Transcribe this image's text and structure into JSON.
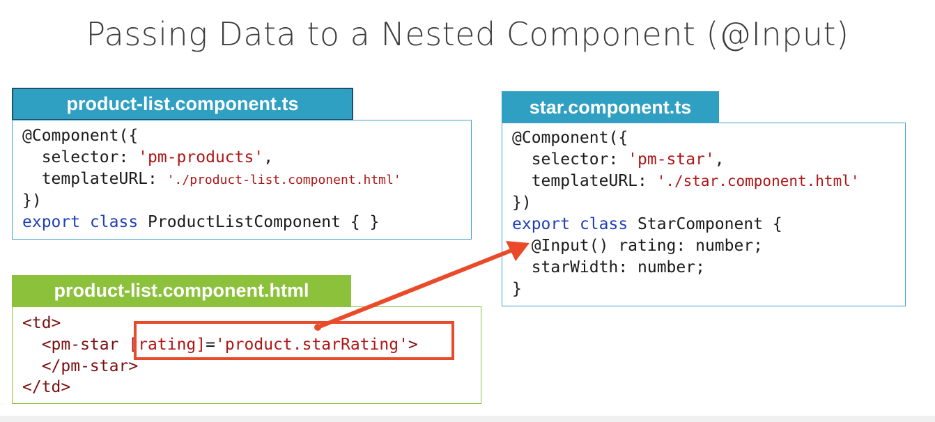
{
  "slide": {
    "title": "Passing Data to a Nested Component (@Input)"
  },
  "product_list_ts": {
    "header": "product-list.component.ts",
    "line1": "@Component({",
    "selector_key": "  selector: ",
    "selector_value": "'pm-products'",
    "selector_end": ",",
    "template_key": "  templateURL: ",
    "template_value": "'./product-list.component.html'",
    "line4": "})",
    "export_kw": "export",
    "class_kw": "class",
    "class_rest": " ProductListComponent { }"
  },
  "product_list_html": {
    "header": "product-list.component.html",
    "line1": "<td>",
    "line2_open": "  <pm-star ",
    "binding_attr": "[rating]",
    "binding_eq": "=",
    "binding_value": "'product.starRating'",
    "line2_close": ">",
    "line3": "  </pm-star>",
    "line4": "</td>"
  },
  "star_ts": {
    "header": "star.component.ts",
    "line1": "@Component({",
    "selector_key": "  selector: ",
    "selector_value": "'pm-star'",
    "selector_end": ",",
    "template_key": "  templateURL: ",
    "template_value": "'./star.component.html'",
    "line4": "})",
    "export_kw": "export",
    "class_kw": "class",
    "class_rest": " StarComponent {",
    "input_line": "  @Input() rating: number;",
    "width_line": "  starWidth: number;",
    "closing": "}"
  },
  "colors": {
    "ts_header": "#2f9fc2",
    "html_header": "#8cc13c",
    "highlight": "#e94b2a",
    "keyword": "#1e3fb5",
    "string": "#b01515"
  }
}
